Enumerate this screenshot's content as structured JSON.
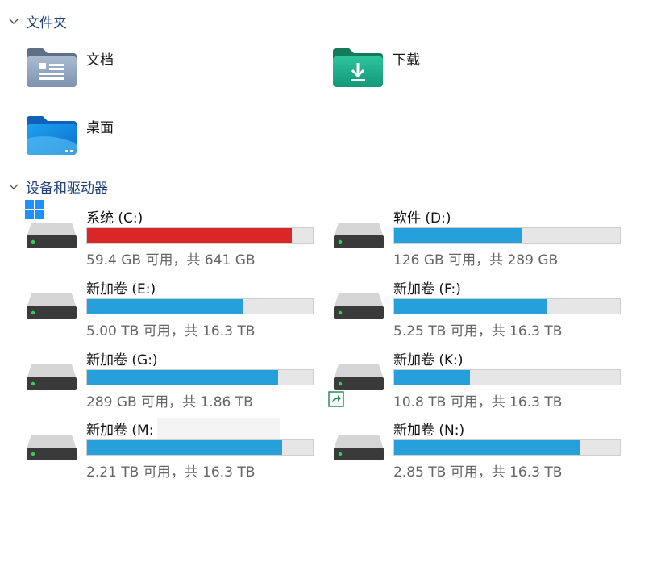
{
  "colors": {
    "accent": "#26a0da",
    "full": "#da2626",
    "header": "#1f3f7a"
  },
  "folders_section": {
    "title": "文件夹",
    "items": [
      {
        "name": "文档",
        "icon": "documents-folder-icon"
      },
      {
        "name": "下载",
        "icon": "downloads-folder-icon"
      },
      {
        "name": "桌面",
        "icon": "desktop-folder-icon"
      }
    ]
  },
  "drives_section": {
    "title": "设备和驱动器",
    "drives": [
      {
        "label": "系统 (C:)",
        "info": "59.4 GB 可用，共 641 GB",
        "used_fraction": 0.907,
        "status": "full"
      },
      {
        "label": "软件 (D:)",
        "info": "126 GB 可用，共 289 GB",
        "used_fraction": 0.564,
        "status": "normal"
      },
      {
        "label": "新加卷 (E:)",
        "info": "5.00 TB 可用，共 16.3 TB",
        "used_fraction": 0.693,
        "status": "normal"
      },
      {
        "label": "新加卷 (F:)",
        "info": "5.25 TB 可用，共 16.3 TB",
        "used_fraction": 0.678,
        "status": "normal"
      },
      {
        "label": "新加卷 (G:)",
        "info": "289 GB 可用，共 1.86 TB",
        "used_fraction": 0.848,
        "status": "normal"
      },
      {
        "label": "新加卷 (K:)",
        "info": "10.8 TB 可用，共 16.3 TB",
        "used_fraction": 0.337,
        "status": "normal"
      },
      {
        "label": "新加卷 (M:",
        "info": "2.21 TB 可用，共 16.3 TB",
        "used_fraction": 0.864,
        "status": "normal"
      },
      {
        "label": "新加卷 (N:)",
        "info": "2.85 TB 可用，共 16.3 TB",
        "used_fraction": 0.825,
        "status": "normal"
      }
    ]
  }
}
